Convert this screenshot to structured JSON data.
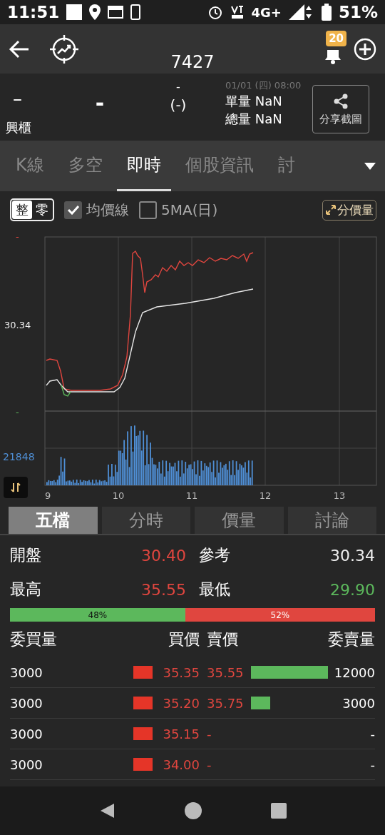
{
  "status_bar": {
    "time": "11:51",
    "network": "4G+",
    "battery": "51%"
  },
  "header": {
    "symbol": "7427",
    "badge": "20"
  },
  "quote": {
    "price": "–",
    "change": "-",
    "change_top": "-",
    "percent": "(-)",
    "market": "興櫃",
    "datetime": "01/01 (四) 08:00",
    "single_volume": {
      "label": "單量",
      "value": "NaN"
    },
    "total_volume": {
      "label": "總量",
      "value": "NaN"
    },
    "share_button": "分享截圖"
  },
  "tabs": [
    {
      "label": "K線",
      "selected": false
    },
    {
      "label": "多空",
      "selected": false
    },
    {
      "label": "即時",
      "selected": true
    },
    {
      "label": "個股資訊",
      "selected": false
    },
    {
      "label": "討",
      "selected": false
    }
  ],
  "chart_controls": {
    "session": [
      {
        "label": "整",
        "selected": true
      },
      {
        "label": "零",
        "selected": false
      }
    ],
    "checkboxes": [
      {
        "label": "均價線",
        "checked": true
      },
      {
        "label": "5MA(日)",
        "checked": false
      }
    ],
    "expand_button": "分價量"
  },
  "chart": {
    "price_labels": [
      {
        "text": "-",
        "color": "#e0463f"
      },
      {
        "text": "30.34",
        "color": "#eeeeee"
      },
      {
        "text": "-",
        "color": "#5cb85c"
      }
    ],
    "volume_label": "21848",
    "time_labels": [
      "9",
      "10",
      "11",
      "12",
      "13"
    ]
  },
  "bottom_tabs": [
    {
      "label": "五檔",
      "selected": true
    },
    {
      "label": "分時",
      "selected": false
    },
    {
      "label": "價量",
      "selected": false
    },
    {
      "label": "討論",
      "selected": false
    }
  ],
  "summary": [
    {
      "label": "開盤",
      "value": "30.40",
      "color": "#e0463f"
    },
    {
      "label": "參考",
      "value": "30.34",
      "color": "#eeeeee"
    },
    {
      "label": "最高",
      "value": "35.55",
      "color": "#e0463f"
    },
    {
      "label": "最低",
      "value": "29.90",
      "color": "#5cb85c"
    }
  ],
  "ratio": {
    "level": 0.48,
    "buy": "48%",
    "sell": "52%"
  },
  "order_book": {
    "columns": [
      "委買量",
      "買價",
      "賣價",
      "委賣量"
    ],
    "rows": [
      {
        "bid_volume": "3000",
        "bid": "35.35",
        "ask": "35.55",
        "ask_volume": "12000"
      },
      {
        "bid_volume": "3000",
        "bid": "35.20",
        "ask": "35.75",
        "ask_volume": "3000"
      },
      {
        "bid_volume": "3000",
        "bid": "35.15",
        "ask": "-",
        "ask_volume": "-"
      },
      {
        "bid_volume": "3000",
        "bid": "34.00",
        "ask": "-",
        "ask_volume": "-"
      }
    ]
  }
}
